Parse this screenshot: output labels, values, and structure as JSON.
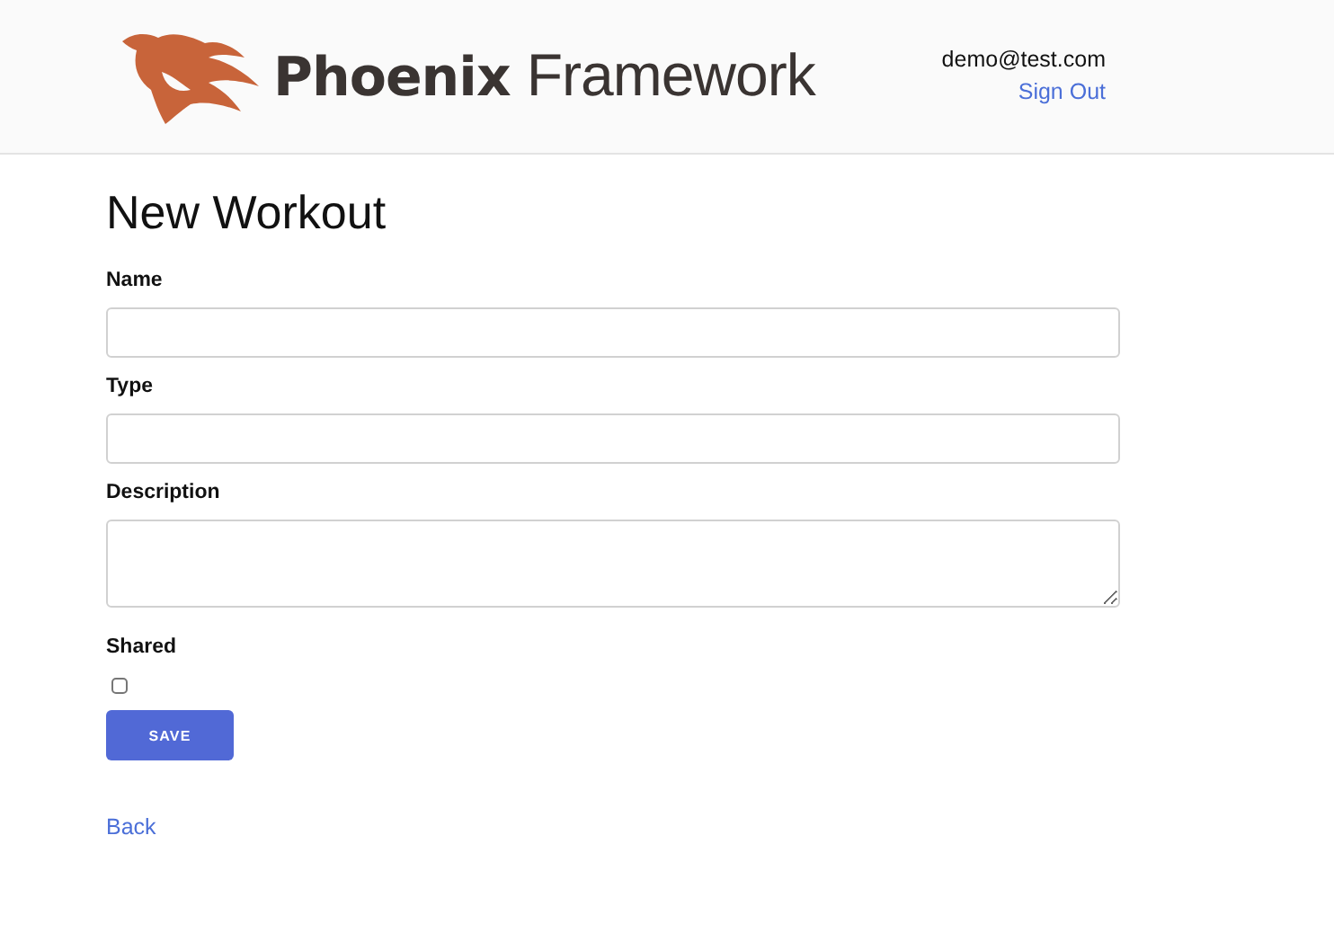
{
  "header": {
    "logo": {
      "bold": "Phoenix",
      "light": "Framework"
    },
    "user_email": "demo@test.com",
    "sign_out": "Sign Out"
  },
  "title": "New Workout",
  "fields": [
    {
      "label": "Name",
      "kind": "text"
    },
    {
      "label": "Type",
      "kind": "text"
    },
    {
      "label": "Description",
      "kind": "textarea"
    },
    {
      "label": "Shared",
      "kind": "checkbox",
      "checked": false
    }
  ],
  "save_button": "SAVE",
  "back_link": "Back"
}
